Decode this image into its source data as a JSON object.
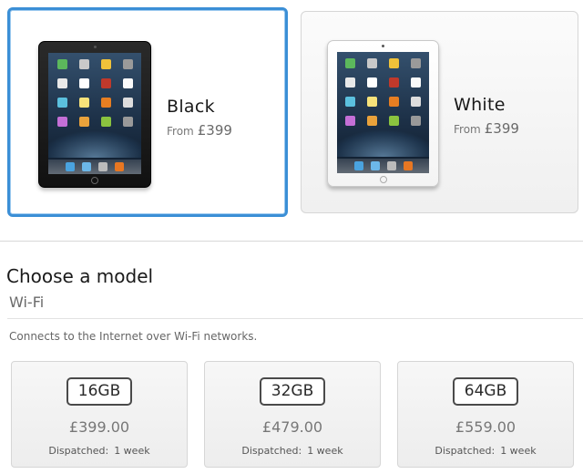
{
  "colors": [
    {
      "name": "Black",
      "from_label": "From",
      "price": "£399",
      "selected": true
    },
    {
      "name": "White",
      "from_label": "From",
      "price": "£399",
      "selected": false
    }
  ],
  "section": {
    "title": "Choose a model",
    "subtitle": "Wi-Fi",
    "description": "Connects to the Internet over Wi-Fi networks."
  },
  "models": [
    {
      "capacity": "16GB",
      "price": "£399.00",
      "dispatch_label": "Dispatched:",
      "dispatch_time": "1 week"
    },
    {
      "capacity": "32GB",
      "price": "£479.00",
      "dispatch_label": "Dispatched:",
      "dispatch_time": "1 week"
    },
    {
      "capacity": "64GB",
      "price": "£559.00",
      "dispatch_label": "Dispatched:",
      "dispatch_time": "1 week"
    }
  ],
  "theme": {
    "selected_border": "#3b8fd6"
  }
}
